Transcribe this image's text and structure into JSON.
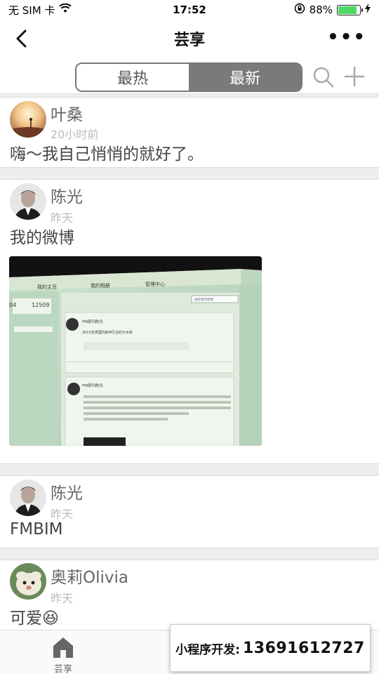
{
  "status_bar": {
    "carrier": "无 SIM 卡",
    "time": "17:52",
    "battery_percent": "88%",
    "battery_level": 0.88
  },
  "nav": {
    "title": "芸享",
    "more": "•••"
  },
  "segment": {
    "tabs": [
      "最热",
      "最新"
    ],
    "selected": "最新"
  },
  "posts": [
    {
      "name": "叶桑",
      "time": "20小时前",
      "text": "嗨～我自己悄悄的就好了。"
    },
    {
      "name": "陈光",
      "time": "昨天",
      "text": "我的微博"
    },
    {
      "name": "陈光",
      "time": "昨天",
      "text": "FMBIM"
    },
    {
      "name": "奥莉Olivia",
      "time": "昨天",
      "text": "可爱😆"
    }
  ],
  "photo": {
    "tabs": [
      "我的主页",
      "我的相册",
      "管理中心"
    ],
    "stat_a": "04",
    "stat_b": "12509",
    "account": "FM周刊陈光",
    "post_line": "2013年意国内BIM行业的分水岭",
    "search_placeholder": "搜索我的微博"
  },
  "tabbar": {
    "items": [
      "芸享",
      "",
      ""
    ]
  },
  "promo": {
    "prefix": "小程序开发:",
    "phone": "13691612727"
  },
  "colors": {
    "segment_selected": "#7a7a7a",
    "battery": "#4cd964"
  }
}
